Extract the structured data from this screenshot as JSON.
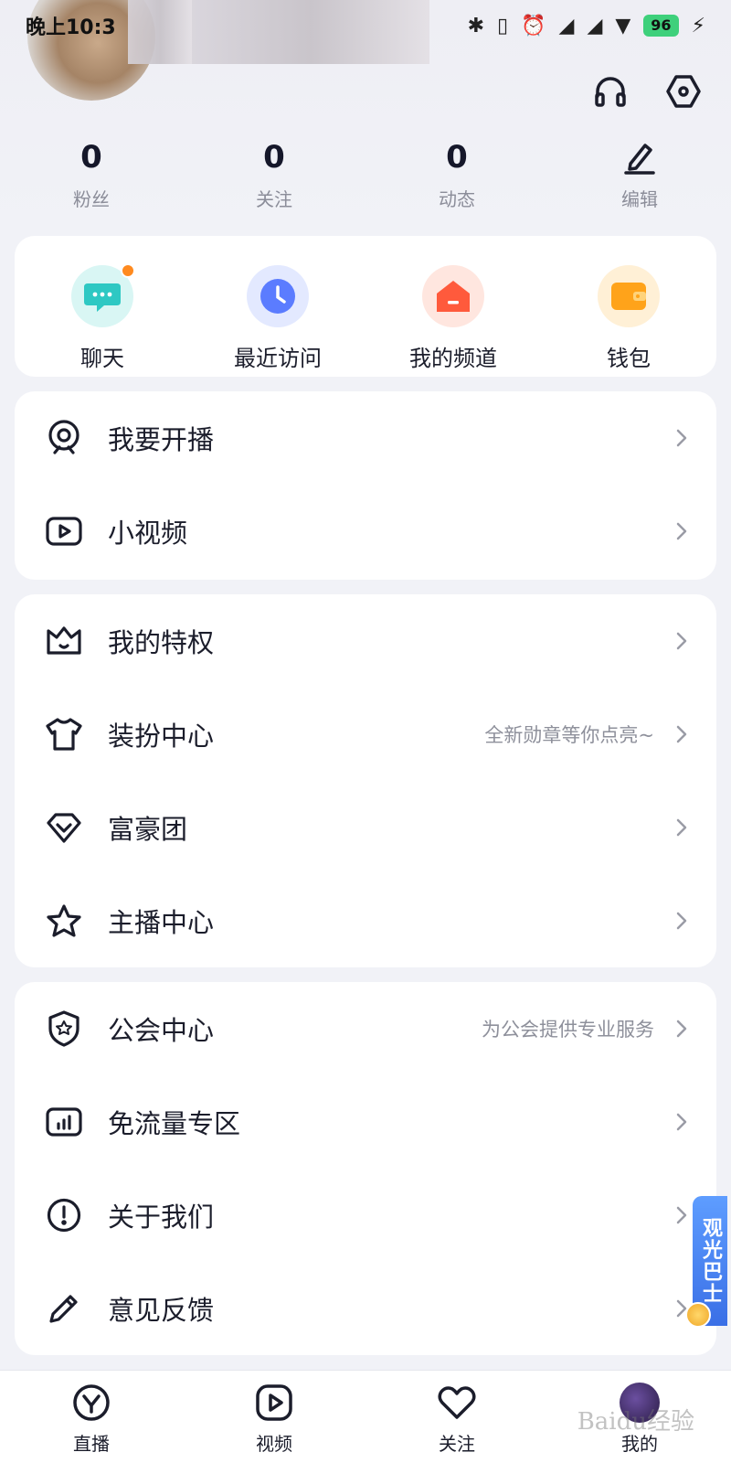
{
  "status_bar": {
    "time": "晚上10:3",
    "battery": "96"
  },
  "stats": [
    {
      "value": "0",
      "label": "粉丝"
    },
    {
      "value": "0",
      "label": "关注"
    },
    {
      "value": "0",
      "label": "动态"
    }
  ],
  "edit_label": "编辑",
  "quick_actions": [
    {
      "label": "聊天",
      "icon": "chat-icon",
      "color": "#2ec8c3"
    },
    {
      "label": "最近访问",
      "icon": "clock-icon",
      "color": "#5b7cff"
    },
    {
      "label": "我的频道",
      "icon": "channel-home-icon",
      "color": "#ff5a3c"
    },
    {
      "label": "钱包",
      "icon": "wallet-icon",
      "color": "#ffa31a"
    }
  ],
  "menu_group_1": [
    {
      "label": "我要开播",
      "icon": "live-camera-icon"
    },
    {
      "label": "小视频",
      "icon": "video-icon"
    }
  ],
  "menu_group_2": [
    {
      "label": "我的特权",
      "icon": "crown-icon"
    },
    {
      "label": "装扮中心",
      "icon": "shirt-icon",
      "hint": "全新勋章等你点亮~"
    },
    {
      "label": "富豪团",
      "icon": "diamond-icon"
    },
    {
      "label": "主播中心",
      "icon": "star-icon"
    }
  ],
  "menu_group_3": [
    {
      "label": "公会中心",
      "icon": "shield-icon",
      "hint": "为公会提供专业服务"
    },
    {
      "label": "免流量专区",
      "icon": "data-chart-icon"
    },
    {
      "label": "关于我们",
      "icon": "info-icon"
    },
    {
      "label": "意见反馈",
      "icon": "pencil-icon"
    }
  ],
  "floating_tag": "观光巴士",
  "bottom_nav": [
    {
      "label": "直播",
      "icon": "live-tab-icon"
    },
    {
      "label": "视频",
      "icon": "video-tab-icon"
    },
    {
      "label": "关注",
      "icon": "heart-icon"
    },
    {
      "label": "我的",
      "icon": "profile-avatar-icon"
    }
  ],
  "watermark": "Baidu经验",
  "colors": {
    "accent_dark": "#1b1d2b",
    "hint_gray": "#8e909b",
    "badge_orange": "#ff8a1f",
    "battery_green": "#3ed07b"
  }
}
